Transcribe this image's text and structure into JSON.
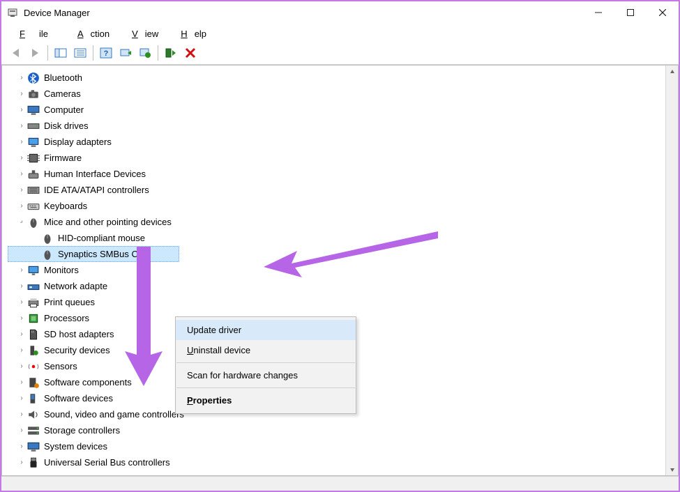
{
  "window": {
    "title": "Device Manager"
  },
  "menu": {
    "file": "File",
    "action": "Action",
    "view": "View",
    "help": "Help"
  },
  "tree": {
    "bluetooth": "Bluetooth",
    "cameras": "Cameras",
    "computer": "Computer",
    "disk_drives": "Disk drives",
    "display_adapters": "Display adapters",
    "firmware": "Firmware",
    "hid": "Human Interface Devices",
    "ide": "IDE ATA/ATAPI controllers",
    "keyboards": "Keyboards",
    "mice": "Mice and other pointing devices",
    "mice_child1": "HID-compliant mouse",
    "mice_child2": "Synaptics SMBus C",
    "monitors": "Monitors",
    "network": "Network adapte",
    "print_queues": "Print queues",
    "processors": "Processors",
    "sd_host": "SD host adapters",
    "security": "Security devices",
    "sensors": "Sensors",
    "sw_components": "Software components",
    "sw_devices": "Software devices",
    "sound": "Sound, video and game controllers",
    "storage": "Storage controllers",
    "system": "System devices",
    "usb": "Universal Serial Bus controllers"
  },
  "context_menu": {
    "update": "Update driver",
    "uninstall": "Uninstall device",
    "scan": "Scan for hardware changes",
    "properties": "Properties"
  }
}
